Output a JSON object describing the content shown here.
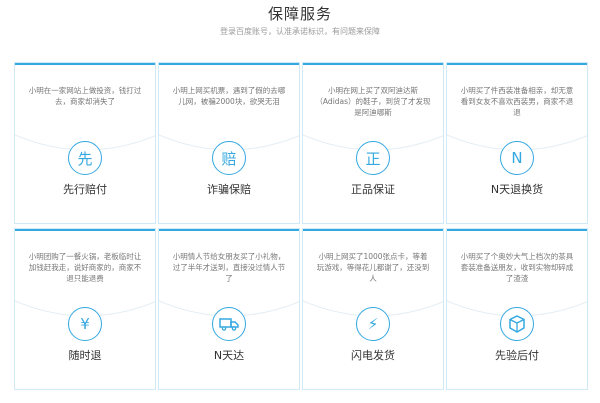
{
  "header": {
    "title": "保障服务",
    "subtitle": "登录百度账号，认准承诺标识，有问题来保障"
  },
  "cards": [
    {
      "icon": "先",
      "icon_name": "xian-icon",
      "label": "先行赔付",
      "desc": "小明在一家网站上做投资，钱打过去，商家却消失了"
    },
    {
      "icon": "赔",
      "icon_name": "pei-icon",
      "label": "诈骗保赔",
      "desc": "小明上网买机票，遇到了假的去哪儿网，被骗2000块，欲哭无泪"
    },
    {
      "icon": "正",
      "icon_name": "zheng-icon",
      "label": "正品保证",
      "desc": "小明在网上买了双阿迪达斯（Adidas）的鞋子，到货了才发现是阿迪哪斯"
    },
    {
      "icon": "N",
      "icon_name": "n-icon",
      "label": "N天退换货",
      "desc": "小明买了件西装准备相亲，却无意看到女友不喜欢西装男，商家不退退"
    },
    {
      "icon": "¥",
      "icon_name": "yen-refund-icon",
      "label": "随时退",
      "desc": "小明团购了一餐火锅，老板临时让加钱赶我走，说好商家的，商家不退只能退费"
    },
    {
      "icon": "truck",
      "icon_name": "truck-icon",
      "label": "N天达",
      "desc": "小明情人节给女朋友买了小礼物，过了半年才送到，直接没过情人节了"
    },
    {
      "icon": "⚡",
      "icon_name": "lightning-icon",
      "label": "闪电发货",
      "desc": "小明上网买了1000张点卡，等着玩游戏，等得花儿都谢了，还没到人"
    },
    {
      "icon": "box",
      "icon_name": "box-icon",
      "label": "先验后付",
      "desc": "小明买了个奥妙大气上档次的茶具套装准备送朋友，收到实物却碎成了渣渣"
    }
  ]
}
